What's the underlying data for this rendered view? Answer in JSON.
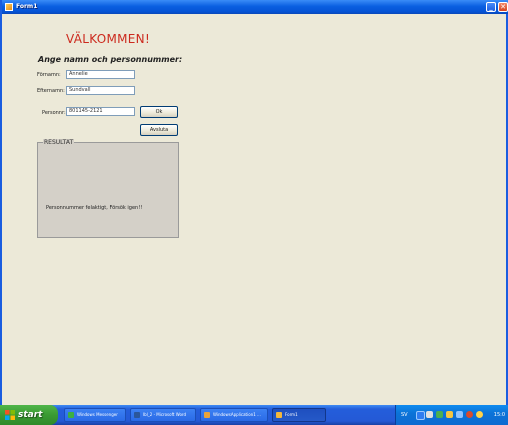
{
  "window": {
    "title": "Form1",
    "minimize_glyph": "_",
    "close_glyph": "✕"
  },
  "form": {
    "welcome": "VÄLKOMMEN!",
    "heading": "Ange namn och personnummer:",
    "firstname_label": "Förnamn:",
    "firstname_value": "Annelie",
    "lastname_label": "Efternamn:",
    "lastname_value": "Sundvall",
    "personnr_label": "Personnr:",
    "personnr_value": "801145-2121",
    "ok_label": "Ok",
    "quit_label": "Avsluta"
  },
  "result": {
    "legend": "RESULTAT",
    "message": "Personnummer felaktigt, Försök igen!!"
  },
  "taskbar": {
    "start_label": "start",
    "items": [
      {
        "label": "Windows Messenger",
        "icon_color": "#3cb043"
      },
      {
        "label": "lbl_2 - Microsoft Word",
        "icon_color": "#2b579a"
      },
      {
        "label": "WindowsApplication1 ...",
        "icon_color": "#e8a33c"
      },
      {
        "label": "Form1",
        "icon_color": "#f4b73c"
      }
    ],
    "tray": {
      "language": "SV",
      "clock": "15:0"
    }
  },
  "colors": {
    "welcome": "#cc2a1e",
    "window_bg": "#ece9d8",
    "groupbox_bg": "#d4d0c8",
    "titlebar": "#0a5fe1",
    "start_green": "#3a9a33",
    "tray_blue": "#0c73d8"
  }
}
